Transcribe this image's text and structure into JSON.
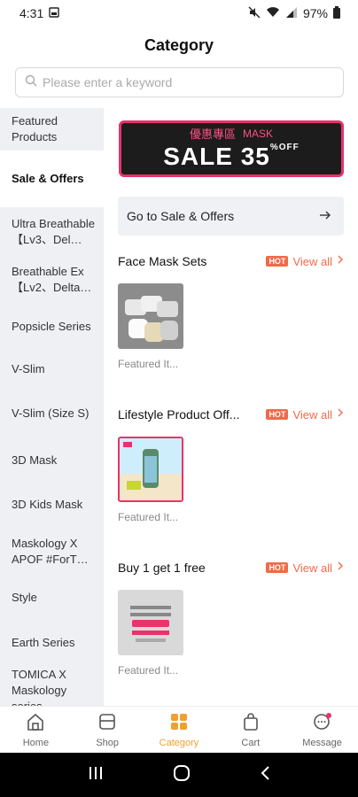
{
  "status": {
    "time": "4:31",
    "battery": "97%"
  },
  "header": {
    "title": "Category"
  },
  "search": {
    "placeholder": "Please enter a keyword"
  },
  "sidebar": {
    "items": [
      {
        "label": "Featured Products"
      },
      {
        "label": "Sale & Offers",
        "active": true
      },
      {
        "label": "Ultra Breathable【Lv3、Del…"
      },
      {
        "label": "Breathable Ex【Lv2、Delta…"
      },
      {
        "label": "Popsicle Series"
      },
      {
        "label": "V-Slim"
      },
      {
        "label": "V-Slim (Size S)"
      },
      {
        "label": "3D Mask"
      },
      {
        "label": "3D Kids Mask"
      },
      {
        "label": "Maskology X APOF #ForT…"
      },
      {
        "label": "Style"
      },
      {
        "label": "Earth Series"
      },
      {
        "label": "TOMICA X Maskology series"
      }
    ]
  },
  "banner": {
    "chinese": "優惠專區",
    "mask": "MASK",
    "sale": "SALE 35",
    "percent": "%",
    "off": "OFF"
  },
  "main": {
    "go_sale_label": "Go to Sale & Offers",
    "sections": [
      {
        "title": "Face Mask Sets",
        "badge": "HOT",
        "view_all": "View all",
        "products": [
          {
            "name": "Featured It..."
          }
        ]
      },
      {
        "title": "Lifestyle Product Off...",
        "badge": "HOT",
        "view_all": "View all",
        "products": [
          {
            "name": "Featured It..."
          }
        ]
      },
      {
        "title": "Buy 1 get 1 free",
        "badge": "HOT",
        "view_all": "View all",
        "products": [
          {
            "name": "Featured It..."
          }
        ]
      }
    ]
  },
  "bottom_nav": {
    "items": [
      {
        "label": "Home",
        "icon": "home-icon"
      },
      {
        "label": "Shop",
        "icon": "shop-icon"
      },
      {
        "label": "Category",
        "icon": "category-icon",
        "active": true
      },
      {
        "label": "Cart",
        "icon": "cart-icon"
      },
      {
        "label": "Message",
        "icon": "message-icon"
      }
    ]
  },
  "colors": {
    "accent": "#f0a030",
    "hot": "#f06a4a",
    "sidebar_bg": "#eef0f4"
  }
}
